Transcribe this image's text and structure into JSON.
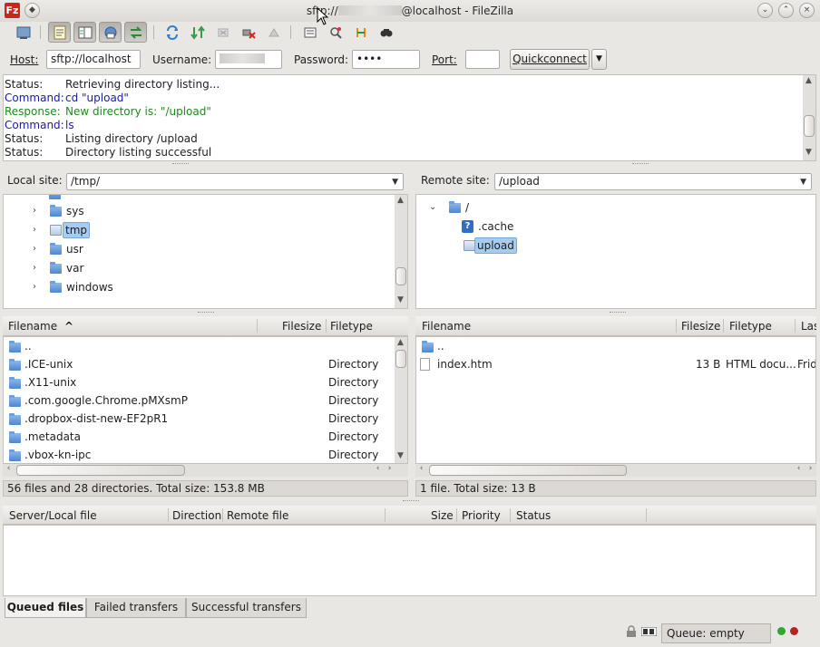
{
  "window": {
    "title_prefix": "sftp://",
    "title_suffix": "@localhost - FileZilla",
    "app_icon_letter": "Fz"
  },
  "toolbar": {
    "icons": [
      "site-manager-icon",
      "message-log-icon",
      "local-tree-icon",
      "remote-tree-icon",
      "transfer-queue-icon",
      "refresh-icon",
      "process-queue-icon",
      "cancel-icon",
      "disconnect-icon",
      "reconnect-icon",
      "filter-icon",
      "compare-icon",
      "sync-browse-icon",
      "search-icon"
    ]
  },
  "quickconnect": {
    "host_label": "Host:",
    "host_value": "sftp://localhost",
    "username_label": "Username:",
    "password_label": "Password:",
    "password_value": "••••",
    "port_label": "Port:",
    "port_value": "",
    "button_label": "Quickconnect",
    "dropdown_glyph": "▼"
  },
  "log": [
    {
      "type": "Status:",
      "message": "Retrieving directory listing...",
      "color": "#1e1e1e"
    },
    {
      "type": "Command:",
      "message": "cd \"upload\"",
      "color": "#1a1aa6"
    },
    {
      "type": "Response:",
      "message": "New directory is: \"/upload\"",
      "color": "#1e8a1e"
    },
    {
      "type": "Command:",
      "message": "ls",
      "color": "#1a1aa6"
    },
    {
      "type": "Status:",
      "message": "Listing directory /upload",
      "color": "#1e1e1e"
    },
    {
      "type": "Status:",
      "message": "Directory listing successful",
      "color": "#1e1e1e"
    }
  ],
  "local": {
    "site_label": "Local site:",
    "site_path": "/tmp/",
    "tree": [
      {
        "name": "sys",
        "selected": false
      },
      {
        "name": "tmp",
        "selected": true
      },
      {
        "name": "usr",
        "selected": false
      },
      {
        "name": "var",
        "selected": false
      },
      {
        "name": "windows",
        "selected": false
      }
    ],
    "columns": {
      "filename": "Filename",
      "sort_glyph": "^",
      "filesize": "Filesize",
      "filetype": "Filetype"
    },
    "files": [
      {
        "name": "..",
        "size": "",
        "type": ""
      },
      {
        "name": ".ICE-unix",
        "size": "",
        "type": "Directory"
      },
      {
        "name": ".X11-unix",
        "size": "",
        "type": "Directory"
      },
      {
        "name": ".com.google.Chrome.pMXsmP",
        "size": "",
        "type": "Directory"
      },
      {
        "name": ".dropbox-dist-new-EF2pR1",
        "size": "",
        "type": "Directory"
      },
      {
        "name": ".metadata",
        "size": "",
        "type": "Directory"
      },
      {
        "name": ".vbox-kn-ipc",
        "size": "",
        "type": "Directory"
      }
    ],
    "status": "56 files and 28 directories. Total size: 153.8 MB"
  },
  "remote": {
    "site_label": "Remote site:",
    "site_path": "/upload",
    "tree": [
      {
        "name": "/",
        "kind": "root"
      },
      {
        "name": ".cache",
        "kind": "unknown"
      },
      {
        "name": "upload",
        "kind": "selected"
      }
    ],
    "columns": {
      "filename": "Filename",
      "filesize": "Filesize",
      "filetype": "Filetype",
      "last": "Las"
    },
    "files": [
      {
        "name": "..",
        "size": "",
        "type": "",
        "modified": "",
        "kind": "folder"
      },
      {
        "name": "index.htm",
        "size": "13 B",
        "type": "HTML docu...",
        "modified": "Frid",
        "kind": "file"
      }
    ],
    "status": "1 file. Total size: 13 B"
  },
  "queue": {
    "columns": {
      "server_local": "Server/Local file",
      "direction": "Direction",
      "remote": "Remote file",
      "size": "Size",
      "priority": "Priority",
      "status": "Status"
    },
    "tabs": [
      {
        "label": "Queued files",
        "active": true
      },
      {
        "label": "Failed transfers",
        "active": false
      },
      {
        "label": "Successful transfers",
        "active": false
      }
    ]
  },
  "statusbar": {
    "queue_text": "Queue: empty",
    "lights": [
      "#2ea82e",
      "#b82222"
    ]
  }
}
